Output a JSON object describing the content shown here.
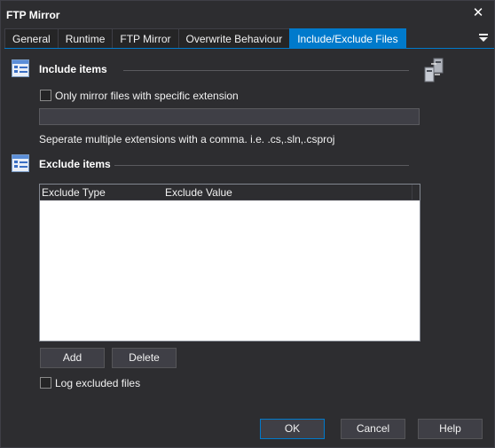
{
  "window": {
    "title": "FTP Mirror",
    "close_glyph": "✕"
  },
  "tabs": [
    {
      "label": "General",
      "active": false
    },
    {
      "label": "Runtime",
      "active": false
    },
    {
      "label": "FTP Mirror",
      "active": false
    },
    {
      "label": "Overwrite Behaviour",
      "active": false
    },
    {
      "label": "Include/Exclude Files",
      "active": true
    }
  ],
  "include": {
    "title": "Include items",
    "checkbox_label": "Only mirror files with specific extension",
    "checkbox_checked": false,
    "extension_value": "",
    "hint": "Seperate multiple extensions with a comma. i.e. .cs,.sln,.csproj"
  },
  "exclude": {
    "title": "Exclude items",
    "columns": [
      "Exclude Type",
      "Exclude Value"
    ],
    "rows": [],
    "add_label": "Add",
    "delete_label": "Delete",
    "log_label": "Log excluded files",
    "log_checked": false
  },
  "footer": {
    "ok_label": "OK",
    "cancel_label": "Cancel",
    "help_label": "Help"
  },
  "colors": {
    "accent": "#007acc",
    "background": "#2d2d30"
  }
}
